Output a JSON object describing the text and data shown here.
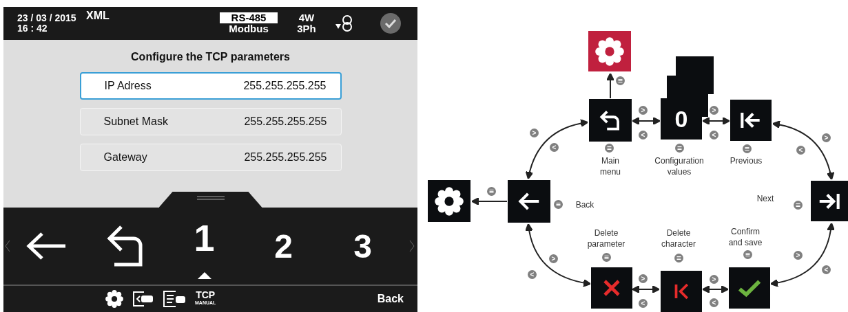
{
  "device": {
    "header": {
      "date": "23 / 03 / 2015",
      "time": "16 : 42",
      "format": "XML",
      "protocol": "RS-485",
      "protocol_mode": "Modbus",
      "wiring": "4W",
      "phases": "3Ph"
    },
    "form": {
      "title": "Configure the TCP parameters",
      "fields": [
        {
          "label": "IP Adress",
          "value": "255.255.255.255",
          "selected": true
        },
        {
          "label": "Subnet Mask",
          "value": "255.255.255.255",
          "selected": false
        },
        {
          "label": "Gateway",
          "value": "255.255.255.255",
          "selected": false
        }
      ]
    },
    "keys": [
      {
        "kind": "back",
        "selected": false
      },
      {
        "kind": "return",
        "selected": false
      },
      {
        "kind": "digit",
        "label": "1",
        "selected": true
      },
      {
        "kind": "digit",
        "label": "2",
        "selected": false
      },
      {
        "kind": "digit",
        "label": "3",
        "selected": false
      }
    ],
    "footer": {
      "mode": "TCP",
      "mode_sub": "MANUAL",
      "back": "Back"
    }
  },
  "diagram": {
    "nodes": [
      {
        "kind": "settings",
        "highlighted": true
      },
      {
        "kind": "card"
      },
      {
        "kind": "card"
      },
      {
        "kind": "return",
        "caption": "Main\nmenu"
      },
      {
        "kind": "digit",
        "digit": "0",
        "caption": "Configuration\nvalues"
      },
      {
        "kind": "previous",
        "caption": "Previous"
      },
      {
        "kind": "settings",
        "highlighted": false
      },
      {
        "kind": "back",
        "caption": "Back"
      },
      {
        "kind": "next",
        "caption": "Next"
      },
      {
        "kind": "delete",
        "caption": "Delete\nparameter"
      },
      {
        "kind": "delete-char",
        "caption": "Delete\ncharacter"
      },
      {
        "kind": "confirm",
        "caption": "Confirm\nand save"
      }
    ],
    "nav_badges": [
      ">",
      "<",
      ">",
      "<",
      ">",
      "<",
      ">",
      "<",
      ">",
      "<",
      ">",
      "<",
      ">",
      "<",
      ">",
      "<"
    ]
  }
}
